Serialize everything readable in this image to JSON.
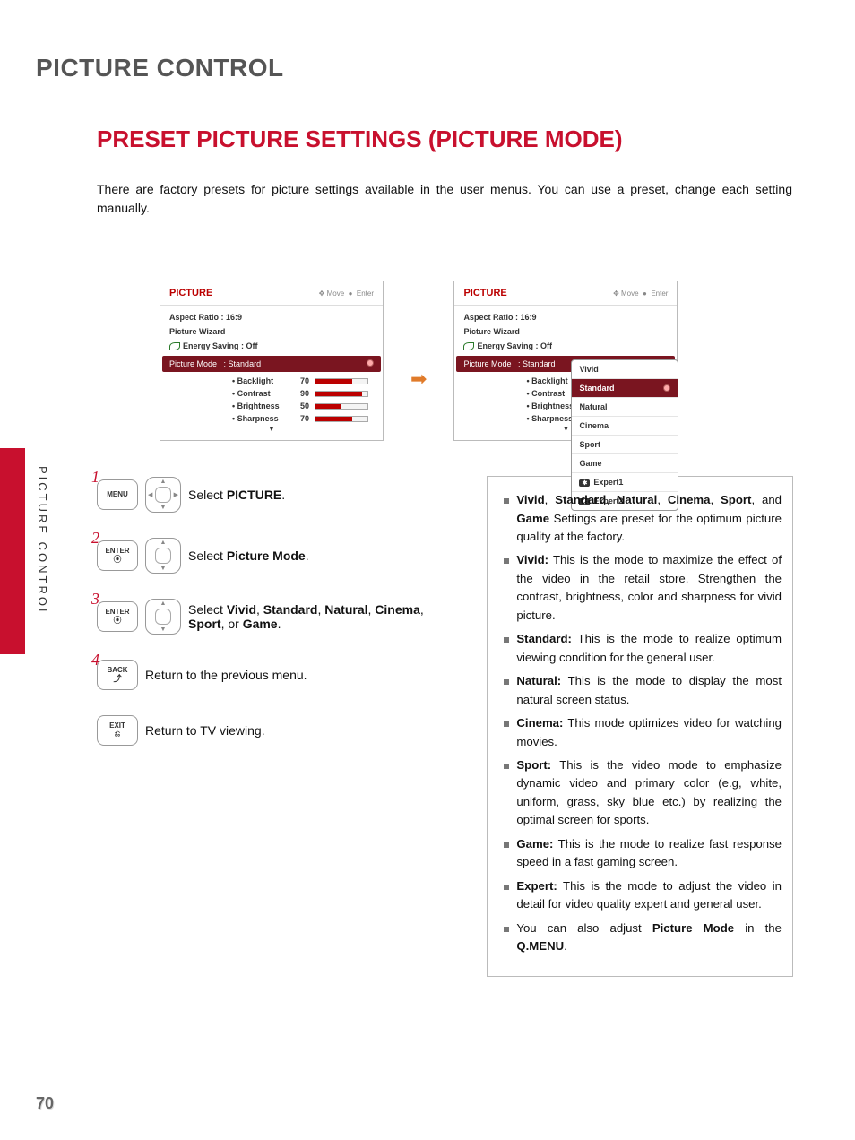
{
  "page_number": "70",
  "side_label": "PICTURE CONTROL",
  "title_main": "PICTURE CONTROL",
  "title_sub": "PRESET PICTURE SETTINGS (PICTURE MODE)",
  "intro": "There are factory presets for picture settings available in the user menus. You can use a preset, change each setting manually.",
  "osd": {
    "header_title": "PICTURE",
    "move_label": "Move",
    "enter_label": "Enter",
    "aspect_line": "Aspect Ratio   : 16:9",
    "wizard_line": "Picture Wizard",
    "energy_line": "Energy Saving : Off",
    "mode_line_label": "Picture Mode",
    "mode_line_value": ": Standard",
    "sliders": [
      {
        "label": "• Backlight",
        "value": "70",
        "pct": 70
      },
      {
        "label": "• Contrast",
        "value": "90",
        "pct": 90
      },
      {
        "label": "• Brightness",
        "value": "50",
        "pct": 50
      },
      {
        "label": "• Sharpness",
        "value": "70",
        "pct": 70
      }
    ],
    "modes": [
      "Vivid",
      "Standard",
      "Natural",
      "Cinema",
      "Sport",
      "Game",
      "Expert1",
      "Expert2"
    ],
    "selected_mode": "Standard"
  },
  "steps": [
    {
      "num": "1",
      "button": "MENU",
      "pad": "cross",
      "text_prefix": "Select ",
      "text_bold": "PICTURE",
      "text_suffix": "."
    },
    {
      "num": "2",
      "button": "ENTER",
      "pad": "updown",
      "text_prefix": "Select ",
      "text_bold": "Picture Mode",
      "text_suffix": "."
    },
    {
      "num": "3",
      "button": "ENTER",
      "pad": "updown",
      "text_prefix": "Select ",
      "text_bold": "Vivid, Standard, Natural, Cinema, Sport,",
      "text_suffix": " or Game."
    },
    {
      "num": "4",
      "button": "BACK",
      "pad": "",
      "text_prefix": "Return to the previous menu.",
      "text_bold": "",
      "text_suffix": ""
    },
    {
      "num": "",
      "button": "EXIT",
      "pad": "",
      "text_prefix": "Return to TV viewing.",
      "text_bold": "",
      "text_suffix": ""
    }
  ],
  "desc": [
    {
      "bold": "Vivid, Standard, Natural, Cinema, Sport,",
      "rest": " and Game Settings are preset for the optimum picture quality at the factory."
    },
    {
      "bold": "Vivid:",
      "rest": " This is the mode to maximize the effect of the video in the retail store. Strengthen the contrast, brightness, color and sharpness for vivid picture."
    },
    {
      "bold": "Standard:",
      "rest": " This is the mode to realize optimum viewing condition for the general user."
    },
    {
      "bold": "Natural:",
      "rest": " This is the mode to display the most natural screen status."
    },
    {
      "bold": "Cinema:",
      "rest": " This mode optimizes video for watching movies."
    },
    {
      "bold": "Sport:",
      "rest": " This is the video mode to emphasize dynamic video and primary color (e.g, white, uniform, grass, sky blue etc.) by realizing the optimal screen for sports."
    },
    {
      "bold": "Game:",
      "rest": " This is the mode to realize fast response speed in a fast gaming screen."
    },
    {
      "bold": "Expert:",
      "rest": " This is the mode to adjust the video in detail for video quality expert and general user."
    },
    {
      "bold": "",
      "rest": "You can also adjust Picture Mode in the Q.MENU."
    }
  ]
}
